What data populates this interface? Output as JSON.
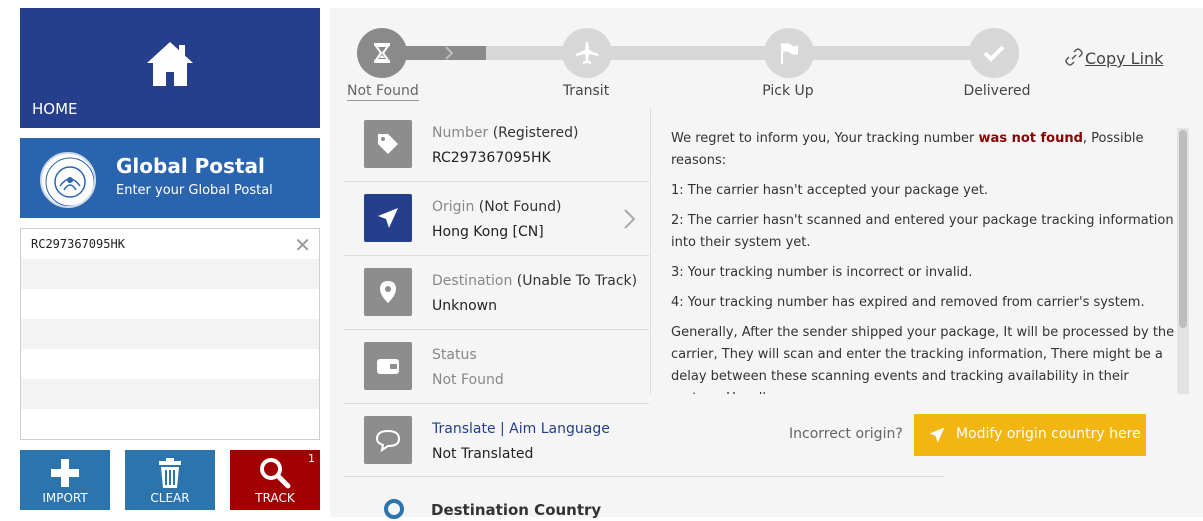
{
  "sidebar": {
    "home_label": "HOME",
    "carrier": {
      "name": "Global Postal",
      "subtitle": "Enter your Global Postal"
    },
    "tracking_input": {
      "value": "RC297367095HK",
      "placeholder": ""
    },
    "actions": {
      "import_label": "IMPORT",
      "clear_label": "CLEAR",
      "track_label": "TRACK",
      "track_count": "1"
    }
  },
  "progress": {
    "steps": [
      {
        "label": "Not Found",
        "icon": "hourglass-icon"
      },
      {
        "label": "Transit",
        "icon": "airplane-icon"
      },
      {
        "label": "Pick Up",
        "icon": "flag-icon"
      },
      {
        "label": "Delivered",
        "icon": "check-icon"
      }
    ],
    "current_step": 1,
    "copy_link_label": "Copy Link"
  },
  "details": {
    "number": {
      "label": "Number",
      "status": "(Registered)",
      "value": "RC297367095HK"
    },
    "origin": {
      "label": "Origin",
      "status": "(Not Found)",
      "value": "Hong Kong [CN]"
    },
    "destination": {
      "label": "Destination",
      "status": "(Unable To Track)",
      "value": "Unknown"
    },
    "status": {
      "label": "Status",
      "value": "Not Found"
    },
    "translate": {
      "label": "Translate | Aim Language",
      "value": "Not Translated"
    }
  },
  "message": {
    "intro_before": "We regret to inform you, Your tracking number ",
    "intro_highlight": "was not found",
    "intro_after": ", Possible reasons:",
    "reasons": [
      "1: The carrier hasn't accepted your package yet.",
      "2: The carrier hasn't scanned and entered your package tracking information into their system yet.",
      "3: Your tracking number is incorrect or invalid.",
      "4: Your tracking number has expired and removed from carrier's system."
    ],
    "general": "Generally, After the sender shipped your package, It will be processed by the carrier, They will scan and enter the tracking information, There might be a delay between these scanning events and tracking availability in their system. Usually"
  },
  "origin_fix": {
    "question": "Incorrect origin?",
    "button_label": "Modify origin country here"
  },
  "destination_section": {
    "title": "Destination Country"
  },
  "colors": {
    "primary": "#253f8c",
    "carrier": "#2b64ae",
    "button_blue": "#2b74ae",
    "track_red": "#a20000",
    "accent": "#f3b511"
  }
}
